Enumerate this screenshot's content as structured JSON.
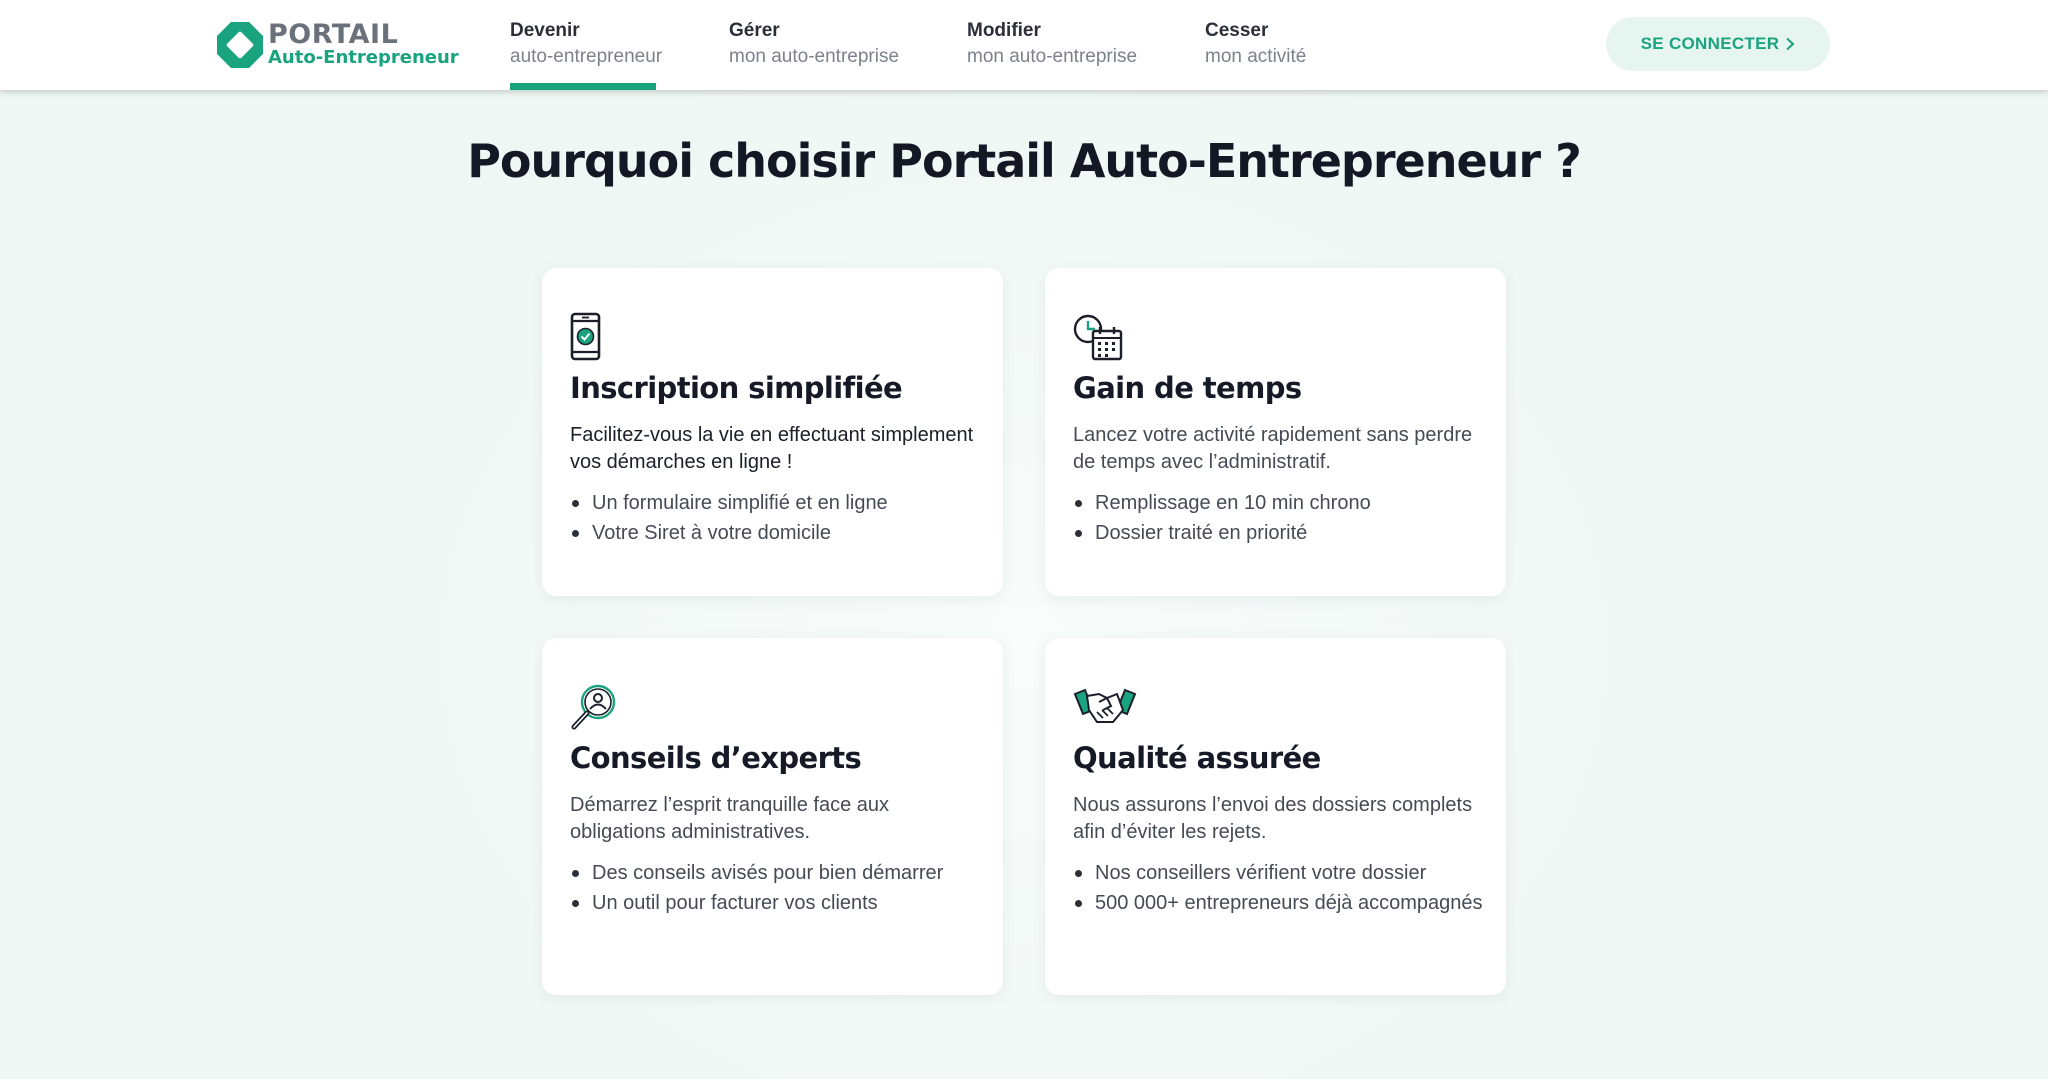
{
  "brand": {
    "name_line1": "PORTAIL",
    "name_line2": "Auto-Entrepreneur",
    "accent_color": "#1aa37f"
  },
  "nav": {
    "items": [
      {
        "line1": "Devenir",
        "line2": "auto-entrepreneur",
        "active": true
      },
      {
        "line1": "Gérer",
        "line2": "mon auto-entreprise",
        "active": false
      },
      {
        "line1": "Modifier",
        "line2": "mon auto-entreprise",
        "active": false
      },
      {
        "line1": "Cesser",
        "line2": "mon activité",
        "active": false
      }
    ],
    "login_label": "SE CONNECTER"
  },
  "page_title": "Pourquoi choisir Portail Auto-Entrepreneur ?",
  "cards": [
    {
      "icon": "smartphone-check-icon",
      "title": "Inscription simplifiée",
      "description": "Facilitez-vous la vie en effectuant simplement vos démarches en ligne !",
      "bullets": [
        "Un formulaire simplifié et en ligne",
        "Votre Siret à votre domicile"
      ]
    },
    {
      "icon": "clock-calendar-icon",
      "title": "Gain de temps",
      "description": "Lancez votre activité rapidement sans perdre de temps avec l’administratif.",
      "bullets": [
        "Remplissage en 10 min chrono",
        "Dossier traité en priorité"
      ]
    },
    {
      "icon": "magnifier-person-icon",
      "title": "Conseils d’experts",
      "description": "Démarrez l’esprit tranquille face aux obligations administratives.",
      "bullets": [
        "Des conseils avisés pour bien démarrer",
        "Un outil pour facturer vos clients"
      ]
    },
    {
      "icon": "handshake-icon",
      "title": "Qualité assurée",
      "description": "Nous assurons l’envoi des dossiers complets afin d’éviter les rejets.",
      "bullets": [
        "Nos conseillers vérifient votre dossier",
        "500 000+ entrepreneurs déjà accompagnés"
      ]
    }
  ]
}
